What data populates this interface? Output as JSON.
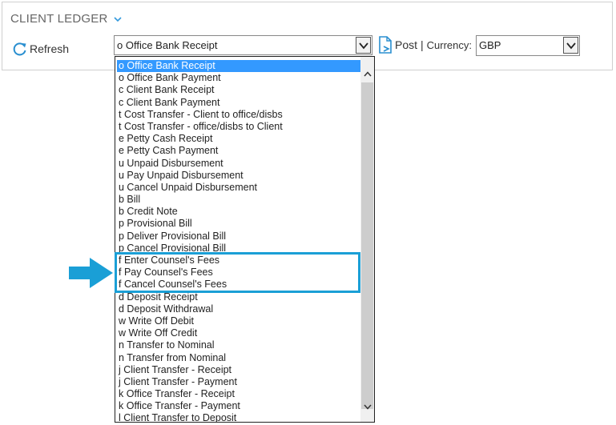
{
  "header": {
    "title": "CLIENT LEDGER"
  },
  "toolbar": {
    "refresh_label": "Refresh",
    "type_select_value": "o Office Bank Receipt",
    "post_label": "Post",
    "separator": "|",
    "currency_label": "Currency:",
    "currency_value": "GBP"
  },
  "dropdown": {
    "items": [
      "o Office Bank Receipt",
      "o Office Bank Payment",
      "c Client Bank Receipt",
      "c Client Bank Payment",
      "t Cost Transfer - Client to office/disbs",
      "t Cost Transfer - office/disbs to Client",
      "e Petty Cash Receipt",
      "e Petty Cash Payment",
      "u Unpaid Disbursement",
      "u Pay Unpaid Disbursement",
      "u Cancel Unpaid Disbursement",
      "b Bill",
      "b Credit Note",
      "p Provisional Bill",
      "p Deliver Provisional Bill",
      "p Cancel Provisional Bill",
      "f Enter Counsel's Fees",
      "f Pay Counsel's Fees",
      "f Cancel Counsel's Fees",
      "d Deposit Receipt",
      "d Deposit Withdrawal",
      "w Write Off Debit",
      "w Write Off Credit",
      "n Transfer to Nominal",
      "n Transfer from Nominal",
      "j Client Transfer - Receipt",
      "j Client Transfer - Payment",
      "k Office Transfer - Receipt",
      "k Office Transfer - Payment",
      "l Client Transfer to Deposit"
    ],
    "selected_index": 0
  },
  "colors": {
    "selection": "#3399ff",
    "highlight_border": "#1a9fd6",
    "arrow": "#1a9fd6"
  }
}
